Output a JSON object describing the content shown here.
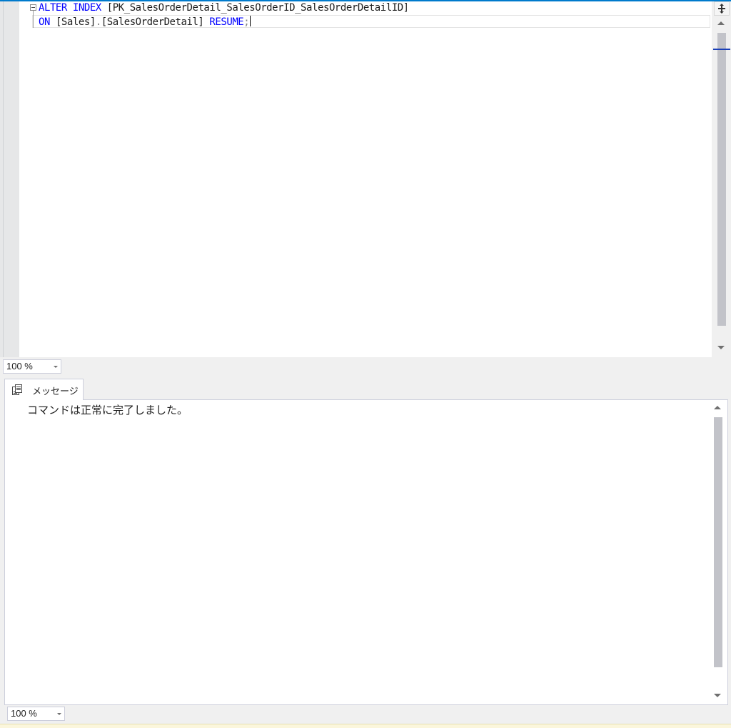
{
  "editor": {
    "line1": {
      "kw1": "ALTER",
      "kw2": "INDEX",
      "index_name": "[PK_SalesOrderDetail_SalesOrderID_SalesOrderDetailID]"
    },
    "line2": {
      "kw_on": "ON",
      "schema": "[Sales]",
      "dot": ".",
      "table": "[SalesOrderDetail]",
      "kw_resume": "RESUME",
      "semicolon": ";"
    },
    "zoom": "100 %"
  },
  "results": {
    "tab_label": "メッセージ",
    "message": "コマンドは正常に完了しました。",
    "zoom": "100 %"
  },
  "icons": {
    "split": "split-handle-icon",
    "messages": "messages-icon"
  },
  "colors": {
    "keyword": "#0000ff",
    "identifier": "#1e1e1e",
    "accent": "#007acc"
  }
}
